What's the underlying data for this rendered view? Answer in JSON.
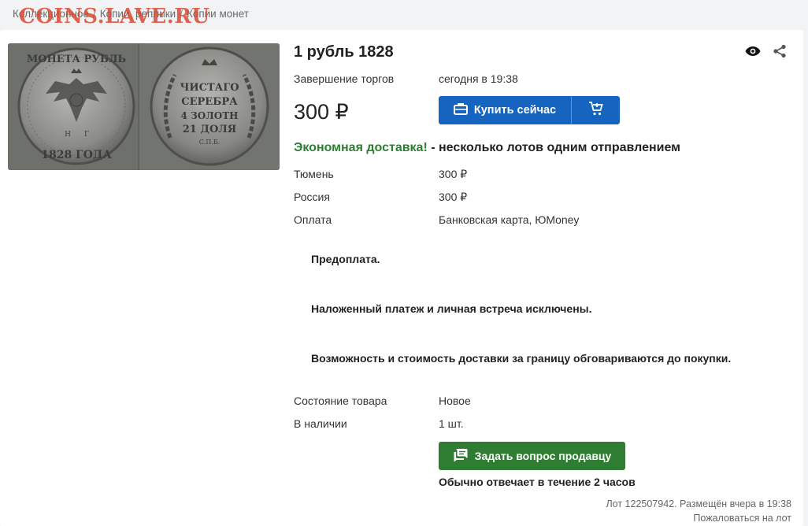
{
  "breadcrumb": {
    "items": [
      "Коллекционное",
      "Копии, реплики",
      "Копии монет"
    ],
    "separator": "/"
  },
  "watermark": "COINS.LAVE.RU",
  "listing": {
    "title": "1 рубль 1828",
    "auction_end_label": "Завершение торгов",
    "auction_end_value": "сегодня в 19:38",
    "price": "300 ₽",
    "buy_now_label": "Купить сейчас",
    "shipping_promo_green": "Экономная доставка!",
    "shipping_promo_rest": " - несколько лотов одним отправлением",
    "shipping_rows": [
      {
        "label": "Тюмень",
        "value": "300 ₽"
      },
      {
        "label": "Россия",
        "value": "300 ₽"
      },
      {
        "label": "Оплата",
        "value": "Банковская карта, ЮMoney"
      }
    ],
    "notes": [
      "Предоплата.",
      "Наложенный платеж и личная встреча исключены.",
      "Возможность и стоимость доставки за границу обговариваются до покупки."
    ],
    "condition_label": "Состояние товара",
    "condition_value": "Новое",
    "stock_label": "В наличии",
    "stock_value": "1 шт.",
    "ask_seller_label": "Задать вопрос продавцу",
    "reply_time": "Обычно отвечает в течение 2 часов",
    "lot_info": "Лот 122507942. Размещён вчера в 19:38",
    "report_label": "Пожаловаться на лот"
  },
  "coin_obverse": {
    "top": "МОНЕТА  РУБЛЬ",
    "bottom": "1828  ГОДА",
    "mint_left": "Н",
    "mint_right": "Г"
  },
  "coin_reverse": {
    "lines": [
      "ЧИСТАГО",
      "СЕРЕБРА",
      "4 ЗОЛОТН",
      "21 ДОЛЯ"
    ],
    "mint": "С.П.Б."
  },
  "colors": {
    "accent_blue": "#1565c0",
    "accent_green": "#2e7d32",
    "promo_green": "#2e7d32",
    "watermark_red": "#d9442c"
  },
  "icons": {
    "watch": "eye-icon",
    "share": "share-icon",
    "buy": "briefcase-icon",
    "cart": "add-to-cart-icon",
    "ask": "chat-icon"
  }
}
